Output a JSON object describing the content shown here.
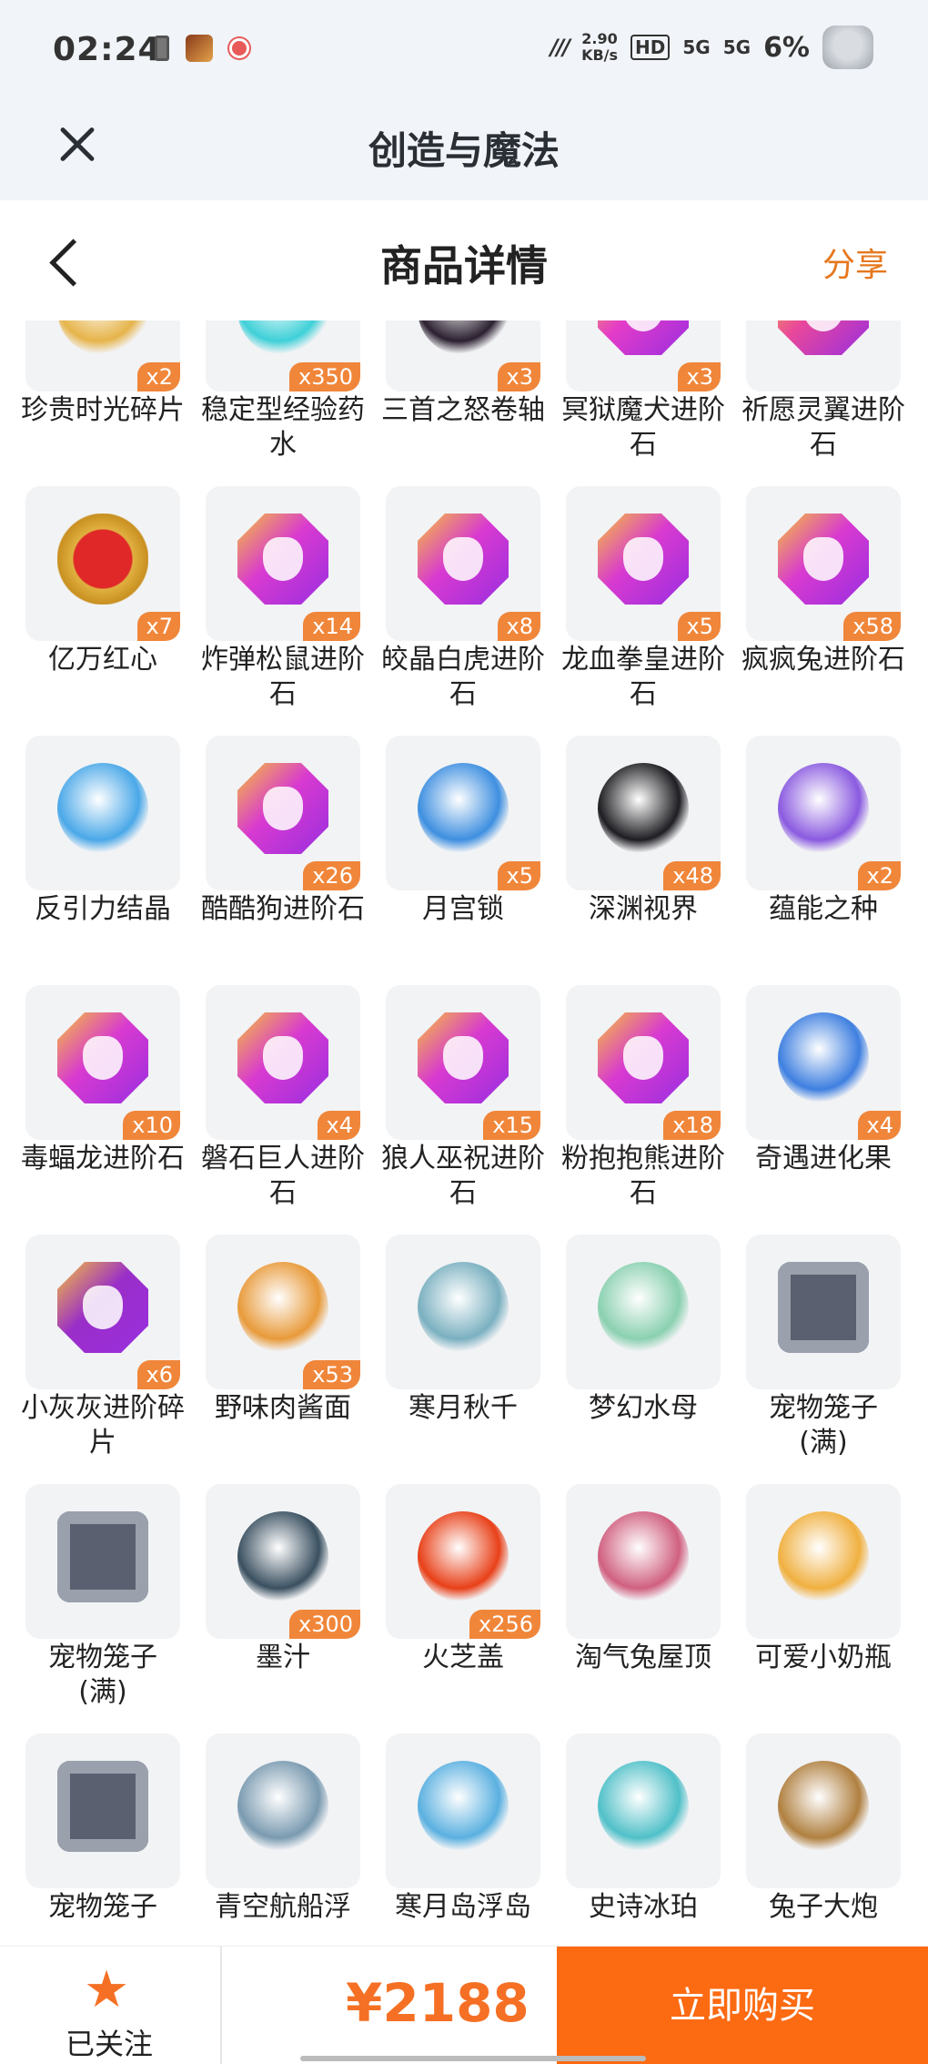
{
  "status_bar": {
    "time": "02:24",
    "speed": "2.90\nKB/s",
    "hd": "HD",
    "signal1": "5G",
    "signal2": "5G",
    "battery": "6%"
  },
  "titlebar": {
    "title": "创造与魔法"
  },
  "header": {
    "title": "商品详情",
    "share": "分享"
  },
  "colors": {
    "accent": "#f57024",
    "buy": "#fc6a12",
    "qty_badge": "#f0863a"
  },
  "items": [
    {
      "name": "珍贵时光碎片",
      "qty": "x2",
      "icon": "time-fragment-icon",
      "color": "#e6b44a"
    },
    {
      "name": "稳定型经验药水",
      "qty": "x350",
      "icon": "potion-icon",
      "color": "#3fd0d8"
    },
    {
      "name": "三首之怒卷轴",
      "qty": "x3",
      "icon": "scroll-icon",
      "color": "#2b2030"
    },
    {
      "name": "冥狱魔犬进阶石",
      "qty": "x3",
      "icon": "gem-icon",
      "color": "#e43cc8"
    },
    {
      "name": "祈愿灵翼进阶石",
      "qty": "",
      "icon": "gem-icon",
      "color": "#e9489a"
    },
    {
      "name": "亿万红心",
      "qty": "x7",
      "icon": "heart-icon",
      "color": "#e02828"
    },
    {
      "name": "炸弹松鼠进阶石",
      "qty": "x14",
      "icon": "gem-icon",
      "color": "#d83ad0"
    },
    {
      "name": "皎晶白虎进阶石",
      "qty": "x8",
      "icon": "gem-icon",
      "color": "#d83ad0"
    },
    {
      "name": "龙血拳皇进阶石",
      "qty": "x5",
      "icon": "gem-icon",
      "color": "#d83ad0"
    },
    {
      "name": "疯疯兔进阶石",
      "qty": "x58",
      "icon": "gem-icon",
      "color": "#d83ad0"
    },
    {
      "name": "反引力结晶",
      "qty": "",
      "icon": "crystal-icon",
      "color": "#4aa8e8"
    },
    {
      "name": "酷酷狗进阶石",
      "qty": "x26",
      "icon": "gem-icon",
      "color": "#d83ad0"
    },
    {
      "name": "月宫锁",
      "qty": "x5",
      "icon": "lock-icon",
      "color": "#3e8fe0"
    },
    {
      "name": "深渊视界",
      "qty": "x48",
      "icon": "vortex-icon",
      "color": "#1e1e22"
    },
    {
      "name": "蕴能之种",
      "qty": "x2",
      "icon": "seed-icon",
      "color": "#8a5ae0"
    },
    {
      "name": "毒蝠龙进阶石",
      "qty": "x10",
      "icon": "gem-icon",
      "color": "#d83ad0"
    },
    {
      "name": "磐石巨人进阶石",
      "qty": "x4",
      "icon": "gem-icon",
      "color": "#d83ad0"
    },
    {
      "name": "狼人巫祝进阶石",
      "qty": "x15",
      "icon": "gem-icon",
      "color": "#d83ad0"
    },
    {
      "name": "粉抱抱熊进阶石",
      "qty": "x18",
      "icon": "gem-icon",
      "color": "#d83ad0"
    },
    {
      "name": "奇遇进化果",
      "qty": "x4",
      "icon": "fruit-icon",
      "color": "#3e7fe0"
    },
    {
      "name": "小灰灰进阶碎片",
      "qty": "x6",
      "icon": "gem-icon",
      "color": "#9a2ec8"
    },
    {
      "name": "野味肉酱面",
      "qty": "x53",
      "icon": "noodles-icon",
      "color": "#e89a3a"
    },
    {
      "name": "寒月秋千",
      "qty": "",
      "icon": "swing-icon",
      "color": "#7ab0c0"
    },
    {
      "name": "梦幻水母",
      "qty": "",
      "icon": "jellyfish-icon",
      "color": "#8ad0b0"
    },
    {
      "name": "宠物笼子\n(满)",
      "qty": "",
      "icon": "pet-cage-icon",
      "color": "#5a6070"
    },
    {
      "name": "宠物笼子\n(满)",
      "qty": "",
      "icon": "pet-cage-icon",
      "color": "#5a6070"
    },
    {
      "name": "墨汁",
      "qty": "x300",
      "icon": "ink-bottle-icon",
      "color": "#3a5060"
    },
    {
      "name": "火芝盖",
      "qty": "x256",
      "icon": "mushroom-icon",
      "color": "#e84018"
    },
    {
      "name": "淘气兔屋顶",
      "qty": "",
      "icon": "roof-icon",
      "color": "#d06080"
    },
    {
      "name": "可爱小奶瓶",
      "qty": "",
      "icon": "baby-bottle-icon",
      "color": "#f0b040"
    },
    {
      "name": "宠物笼子",
      "qty": "",
      "icon": "pet-cage-icon",
      "color": "#5a6070"
    },
    {
      "name": "青空航船浮",
      "qty": "",
      "icon": "airship-icon",
      "color": "#7a9ab0"
    },
    {
      "name": "寒月岛浮岛",
      "qty": "",
      "icon": "island-icon",
      "color": "#5ab0e0"
    },
    {
      "name": "史诗冰珀",
      "qty": "",
      "icon": "spear-icon",
      "color": "#50c0c8"
    },
    {
      "name": "兔子大炮",
      "qty": "",
      "icon": "cannon-icon",
      "color": "#b08040"
    }
  ],
  "bottom": {
    "follow_label": "已关注",
    "price": "¥2188",
    "buy_label": "立即购买"
  }
}
